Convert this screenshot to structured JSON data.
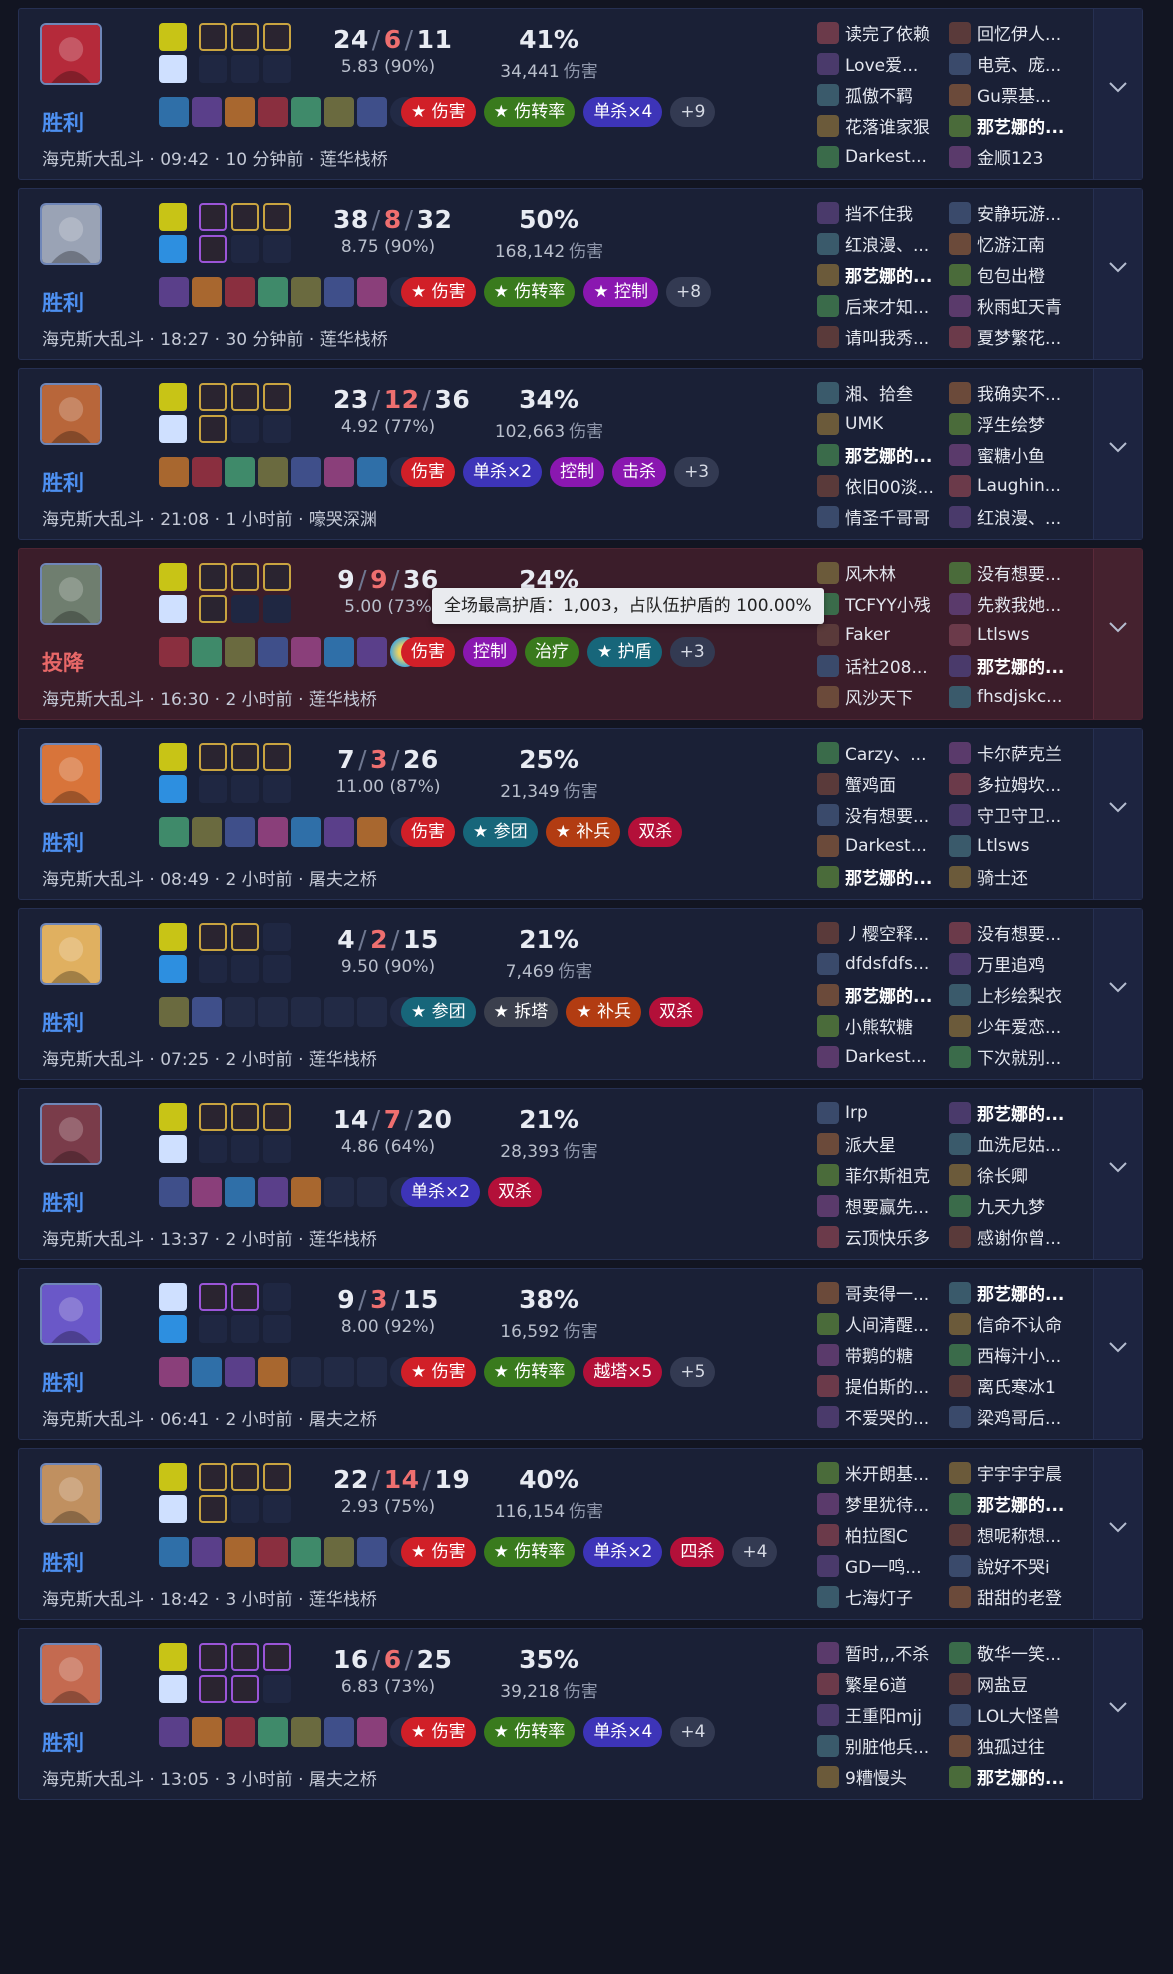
{
  "tag_colors": {
    "red": "#d11f28",
    "green": "#397a1d",
    "blue": "#3d34b8",
    "purple": "#8a17b0",
    "teal": "#17667a",
    "gray": "#3b3f4d",
    "orange": "#b23c12",
    "crimson": "#b31039"
  },
  "tooltip": "全场最高护盾：1,003，占队伍护盾的 100.00%",
  "matches": [
    {
      "result": "胜利",
      "mode": "海克斯大乱斗",
      "time": "09:42",
      "duration": "10 分钟前",
      "map": "莲华栈桥",
      "kills": "24",
      "deaths": "6",
      "assists": "11",
      "kda_ratio": "5.83 (90%)",
      "damage_pct": "41%",
      "damage": "34,441",
      "damage_unit": "伤害",
      "avatar_color": "#b52a3a",
      "spells": [
        "#c8c416",
        "#cfe0ff"
      ],
      "runes_on": [
        3,
        0
      ],
      "rune_style": "gold",
      "items": 7,
      "tags": [
        {
          "label": "★ 伤害",
          "color": "red"
        },
        {
          "label": "★ 伤转率",
          "color": "green"
        },
        {
          "label": "单杀×4",
          "color": "blue"
        },
        {
          "label": "+9",
          "color": "plus"
        }
      ],
      "players_left": [
        "读完了依赖",
        "Love爱...",
        "孤傲不羁",
        "花落谁家狠",
        "Darkest..."
      ],
      "players_right": [
        "回忆伊人...",
        "电竞、庞...",
        "Gu票基...",
        "那艺娜的...",
        "金顺123"
      ],
      "self_side": "right",
      "self_index": 3
    },
    {
      "result": "胜利",
      "mode": "海克斯大乱斗",
      "time": "18:27",
      "duration": "30 分钟前",
      "map": "莲华栈桥",
      "kills": "38",
      "deaths": "8",
      "assists": "32",
      "kda_ratio": "8.75 (90%)",
      "damage_pct": "50%",
      "damage": "168,142",
      "damage_unit": "伤害",
      "avatar_color": "#9aa3b5",
      "spells": [
        "#c8c416",
        "#2d8fe0"
      ],
      "runes_on": [
        3,
        1
      ],
      "rune_style": "mix",
      "items": 7,
      "tags": [
        {
          "label": "★ 伤害",
          "color": "red"
        },
        {
          "label": "★ 伤转率",
          "color": "green"
        },
        {
          "label": "★ 控制",
          "color": "purple"
        },
        {
          "label": "+8",
          "color": "plus"
        }
      ],
      "players_left": [
        "挡不住我",
        "红浪漫、...",
        "那艺娜的...",
        "后来才知...",
        "请叫我秀..."
      ],
      "players_right": [
        "安静玩游...",
        "忆游江南",
        "包包出橙",
        "秋雨虹天青",
        "夏梦繁花..."
      ],
      "self_side": "left",
      "self_index": 2
    },
    {
      "result": "胜利",
      "mode": "海克斯大乱斗",
      "time": "21:08",
      "duration": "1 小时前",
      "map": "嚎哭深渊",
      "kills": "23",
      "deaths": "12",
      "assists": "36",
      "kda_ratio": "4.92 (77%)",
      "damage_pct": "34%",
      "damage": "102,663",
      "damage_unit": "伤害",
      "avatar_color": "#b8663a",
      "spells": [
        "#c8c416",
        "#cfe0ff"
      ],
      "runes_on": [
        3,
        1
      ],
      "rune_style": "gold",
      "items": 7,
      "tags": [
        {
          "label": "伤害",
          "color": "red"
        },
        {
          "label": "单杀×2",
          "color": "blue"
        },
        {
          "label": "控制",
          "color": "purple"
        },
        {
          "label": "击杀",
          "color": "purple"
        },
        {
          "label": "+3",
          "color": "plus"
        }
      ],
      "players_left": [
        "湘、拾叁",
        "UMK",
        "那艺娜的...",
        "依旧00淡...",
        "情圣千哥哥"
      ],
      "players_right": [
        "我确实不...",
        "浮生绘梦",
        "蜜糖小鱼",
        "Laughin...",
        "红浪漫、..."
      ],
      "self_side": "left",
      "self_index": 2
    },
    {
      "result": "投降",
      "mode": "海克斯大乱斗",
      "time": "16:30",
      "duration": "2 小时前",
      "map": "莲华栈桥",
      "kills": "9",
      "deaths": "9",
      "assists": "36",
      "kda_ratio": "5.00 (73%",
      "damage_pct": "24%",
      "damage": "",
      "damage_unit": "",
      "avatar_color": "#6f7e6f",
      "spells": [
        "#c8c416",
        "#cfe0ff"
      ],
      "runes_on": [
        3,
        1
      ],
      "rune_style": "white",
      "items": 8,
      "tags": [
        {
          "label": "伤害",
          "color": "red"
        },
        {
          "label": "控制",
          "color": "purple"
        },
        {
          "label": "治疗",
          "color": "green"
        },
        {
          "label": "★ 护盾",
          "color": "teal"
        },
        {
          "label": "+3",
          "color": "plus"
        }
      ],
      "players_left": [
        "风木林",
        "TCFYY小残",
        "Faker",
        "话社208...",
        "风沙天下"
      ],
      "players_right": [
        "没有想要...",
        "先救我她...",
        "Ltlsws",
        "那艺娜的...",
        "fhsdjskc..."
      ],
      "self_side": "right",
      "self_index": 3
    },
    {
      "result": "胜利",
      "mode": "海克斯大乱斗",
      "time": "08:49",
      "duration": "2 小时前",
      "map": "屠夫之桥",
      "kills": "7",
      "deaths": "3",
      "assists": "26",
      "kda_ratio": "11.00 (87%)",
      "damage_pct": "25%",
      "damage": "21,349",
      "damage_unit": "伤害",
      "avatar_color": "#d8743a",
      "spells": [
        "#c8c416",
        "#2d8fe0"
      ],
      "runes_on": [
        3,
        0
      ],
      "rune_style": "white",
      "items": 7,
      "tags": [
        {
          "label": "伤害",
          "color": "red"
        },
        {
          "label": "★ 参团",
          "color": "teal"
        },
        {
          "label": "★ 补兵",
          "color": "orange"
        },
        {
          "label": "双杀",
          "color": "crimson"
        }
      ],
      "players_left": [
        "Carzy、...",
        "蟹鸡面",
        "没有想要...",
        "Darkest...",
        "那艺娜的..."
      ],
      "players_right": [
        "卡尔萨克兰",
        "多拉姆坎...",
        "守卫守卫...",
        "Ltlsws",
        "骑士还"
      ],
      "self_side": "left",
      "self_index": 4
    },
    {
      "result": "胜利",
      "mode": "海克斯大乱斗",
      "time": "07:25",
      "duration": "2 小时前",
      "map": "莲华栈桥",
      "kills": "4",
      "deaths": "2",
      "assists": "15",
      "kda_ratio": "9.50 (90%)",
      "damage_pct": "21%",
      "damage": "7,469",
      "damage_unit": "伤害",
      "avatar_color": "#e0b060",
      "spells": [
        "#c8c416",
        "#2d8fe0"
      ],
      "runes_on": [
        2,
        0
      ],
      "rune_style": "white",
      "items": 2,
      "tags": [
        {
          "label": "★ 参团",
          "color": "teal"
        },
        {
          "label": "★ 拆塔",
          "color": "gray"
        },
        {
          "label": "★ 补兵",
          "color": "orange"
        },
        {
          "label": "双杀",
          "color": "crimson"
        }
      ],
      "players_left": [
        "丿樱空释...",
        "dfdsfdfs...",
        "那艺娜的...",
        "小熊软糖",
        "Darkest..."
      ],
      "players_right": [
        "没有想要...",
        "万里追鸡",
        "上杉绘梨衣",
        "少年爱恋...",
        "下次就别..."
      ],
      "self_side": "left",
      "self_index": 2
    },
    {
      "result": "胜利",
      "mode": "海克斯大乱斗",
      "time": "13:37",
      "duration": "2 小时前",
      "map": "莲华栈桥",
      "kills": "14",
      "deaths": "7",
      "assists": "20",
      "kda_ratio": "4.86 (64%)",
      "damage_pct": "21%",
      "damage": "28,393",
      "damage_unit": "伤害",
      "avatar_color": "#7a3c4a",
      "spells": [
        "#c8c416",
        "#cfe0ff"
      ],
      "runes_on": [
        3,
        0
      ],
      "rune_style": "white",
      "items": 5,
      "tags": [
        {
          "label": "单杀×2",
          "color": "blue"
        },
        {
          "label": "双杀",
          "color": "crimson"
        }
      ],
      "players_left": [
        "Irp",
        "派大星",
        "菲尔斯祖克",
        "想要赢先...",
        "云顶快乐多"
      ],
      "players_right": [
        "那艺娜的...",
        "血洗尼姑...",
        "徐长卿",
        "九天九梦",
        "感谢你曾..."
      ],
      "self_side": "right",
      "self_index": 0
    },
    {
      "result": "胜利",
      "mode": "海克斯大乱斗",
      "time": "06:41",
      "duration": "2 小时前",
      "map": "屠夫之桥",
      "kills": "9",
      "deaths": "3",
      "assists": "15",
      "kda_ratio": "8.00 (92%)",
      "damage_pct": "38%",
      "damage": "16,592",
      "damage_unit": "伤害",
      "avatar_color": "#6a58c8",
      "spells": [
        "#cfe0ff",
        "#2d8fe0"
      ],
      "runes_on": [
        2,
        0
      ],
      "rune_style": "violet",
      "items": 4,
      "tags": [
        {
          "label": "★ 伤害",
          "color": "red"
        },
        {
          "label": "★ 伤转率",
          "color": "green"
        },
        {
          "label": "越塔×5",
          "color": "crimson"
        },
        {
          "label": "+5",
          "color": "plus"
        }
      ],
      "players_left": [
        "哥卖得一...",
        "人间清醒...",
        "带鹅的糖",
        "提伯斯的...",
        "不爱哭的..."
      ],
      "players_right": [
        "那艺娜的...",
        "信命不认命",
        "西梅汁小...",
        "离氏寒冰1",
        "梁鸡哥后..."
      ],
      "self_side": "right",
      "self_index": 0
    },
    {
      "result": "胜利",
      "mode": "海克斯大乱斗",
      "time": "18:42",
      "duration": "3 小时前",
      "map": "莲华栈桥",
      "kills": "22",
      "deaths": "14",
      "assists": "19",
      "kda_ratio": "2.93 (75%)",
      "damage_pct": "40%",
      "damage": "116,154",
      "damage_unit": "伤害",
      "avatar_color": "#c09060",
      "spells": [
        "#c8c416",
        "#cfe0ff"
      ],
      "runes_on": [
        3,
        1
      ],
      "rune_style": "gold",
      "items": 7,
      "tags": [
        {
          "label": "★ 伤害",
          "color": "red"
        },
        {
          "label": "★ 伤转率",
          "color": "green"
        },
        {
          "label": "单杀×2",
          "color": "blue"
        },
        {
          "label": "四杀",
          "color": "crimson"
        },
        {
          "label": "+4",
          "color": "plus"
        }
      ],
      "players_left": [
        "米开朗基...",
        "梦里犹待...",
        "柏拉图C",
        "GD一鸣...",
        "七海灯子"
      ],
      "players_right": [
        "宇宇宇宇晨",
        "那艺娜的...",
        "想呢称想...",
        "說好不哭i",
        "甜甜的老登"
      ],
      "self_side": "right",
      "self_index": 1
    },
    {
      "result": "胜利",
      "mode": "海克斯大乱斗",
      "time": "13:05",
      "duration": "3 小时前",
      "map": "屠夫之桥",
      "kills": "16",
      "deaths": "6",
      "assists": "25",
      "kda_ratio": "6.83 (73%)",
      "damage_pct": "35%",
      "damage": "39,218",
      "damage_unit": "伤害",
      "avatar_color": "#c46a50",
      "spells": [
        "#c8c416",
        "#cfe0ff"
      ],
      "runes_on": [
        3,
        2
      ],
      "rune_style": "violet",
      "items": 7,
      "tags": [
        {
          "label": "★ 伤害",
          "color": "red"
        },
        {
          "label": "★ 伤转率",
          "color": "green"
        },
        {
          "label": "单杀×4",
          "color": "blue"
        },
        {
          "label": "+4",
          "color": "plus"
        }
      ],
      "players_left": [
        "暂时,,,不杀",
        "繁星6道",
        "王重阳mjj",
        "别脏他兵...",
        "9糟慢头"
      ],
      "players_right": [
        "敬华一笑...",
        "网盐豆",
        "LOL大怪兽",
        "独孤过往",
        "那艺娜的..."
      ],
      "self_side": "right",
      "self_index": 4
    }
  ]
}
